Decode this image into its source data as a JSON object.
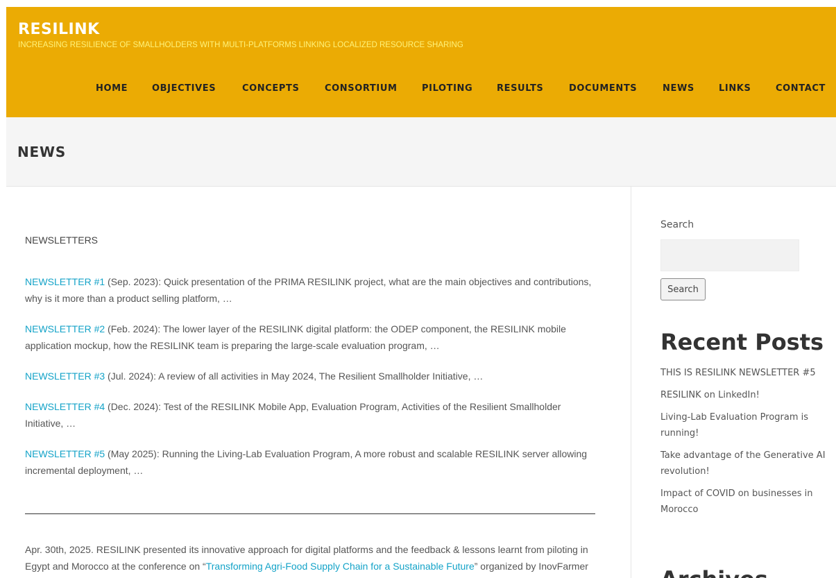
{
  "site": {
    "title": "RESILINK",
    "tagline": "INCREASING RESILIENCE OF SMALLHOLDERS WITH MULTI-PLATFORMS LINKING LOCALIZED RESOURCE SHARING"
  },
  "nav": {
    "items": [
      {
        "label": "HOME"
      },
      {
        "label": "OBJECTIVES"
      },
      {
        "label": "CONCEPTS"
      },
      {
        "label": "CONSORTIUM"
      },
      {
        "label": "PILOTING"
      },
      {
        "label": "RESULTS"
      },
      {
        "label": "DOCUMENTS"
      },
      {
        "label": "NEWS"
      },
      {
        "label": "LINKS"
      },
      {
        "label": "CONTACT"
      }
    ]
  },
  "page": {
    "title": "NEWS"
  },
  "content": {
    "section_label": "NEWSLETTERS",
    "newsletters": [
      {
        "link": "NEWSLETTER #1",
        "text": " (Sep. 2023): Quick presentation of the PRIMA RESILINK project, what are the main objectives and contributions, why is it more than a product selling platform, …"
      },
      {
        "link": "NEWSLETTER #2",
        "text": " (Feb. 2024): The lower layer of the RESILINK digital platform: the ODEP component, the RESILINK mobile application mockup, how the RESILINK team is preparing the large-scale evaluation program, …"
      },
      {
        "link": "NEWSLETTER #3",
        "text": " (Jul. 2024): A review of all activities in May 2024, The Resilient Smallholder Initiative, …"
      },
      {
        "link": "NEWSLETTER #4",
        "text": " (Dec. 2024): Test of the RESILINK Mobile App, Evaluation Program, Activities of the Resilient Smallholder Initiative, …"
      },
      {
        "link": "NEWSLETTER #5",
        "text": " (May 2025): Running the Living-Lab Evaluation Program, A more robust and scalable RESILINK server allowing incremental deployment, …"
      }
    ],
    "news": {
      "text_before": "Apr. 30th, 2025. RESILINK presented its innovative approach for digital platforms and the feedback & lessons learnt from piloting in Egypt and Morocco at the conference on “",
      "link": "Transforming Agri-Food Supply Chain for a Sustainable Future",
      "text_after": "” organized by InovFarmer MED, in collaboration with the Arab Academy of Science, Technology, and Maritime Transport"
    }
  },
  "sidebar": {
    "search": {
      "label": "Search",
      "value": "",
      "button": "Search"
    },
    "recent_posts": {
      "title": "Recent Posts",
      "items": [
        {
          "label": "THIS IS RESILINK NEWSLETTER #5"
        },
        {
          "label": "RESILINK on LinkedIn!"
        },
        {
          "label": "Living-Lab Evaluation Program is running!"
        },
        {
          "label": "Take advantage of the Generative AI revolution!"
        },
        {
          "label": "Impact of COVID on businesses in Morocco"
        }
      ]
    },
    "archives": {
      "title": "Archives"
    }
  },
  "colors": {
    "header_bg": "#ebab04",
    "tagline": "#fff27a",
    "link": "#14a3c8",
    "title_bar_bg": "#f5f5f5"
  }
}
